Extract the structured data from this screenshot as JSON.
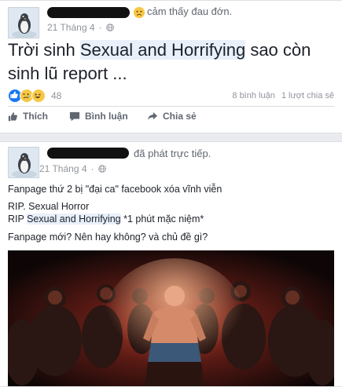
{
  "post1": {
    "action": "cảm thấy đau đớn.",
    "mood": "đau đớn",
    "timestamp": "21 Tháng 4",
    "text_line1_pre": "Trời sinh ",
    "text_highlight": "Sexual and Horrifying",
    "text_line1_post": " sao còn",
    "text_line2": "sinh lũ report ...",
    "reaction_count": "48",
    "comments": "8 bình luận",
    "shares": "1 lượt chia sẻ",
    "actions": {
      "like": "Thích",
      "comment": "Bình luận",
      "share": "Chia sẻ"
    }
  },
  "post2": {
    "action": "đã phát trực tiếp.",
    "timestamp": "21 Tháng 4",
    "line1": "Fanpage thứ 2 bị \"đại ca\" facebook xóa vĩnh viễn",
    "line2": "RIP. Sexual Horror",
    "line3_pre": "RIP ",
    "line3_highlight": "Sexual and Horrifying",
    "line3_post": " *1 phút mặc niệm*",
    "line4": "Fanpage mới? Nên hay không? và chủ đề gì?"
  },
  "colors": {
    "reaction_like": "#1877f2",
    "reaction_sad": "#f7c846",
    "reaction_haha": "#f7c846",
    "highlight": "#e9f0fb"
  },
  "icons": [
    "globe-icon",
    "like-icon",
    "comment-icon",
    "share-icon",
    "sad-mood-icon"
  ]
}
